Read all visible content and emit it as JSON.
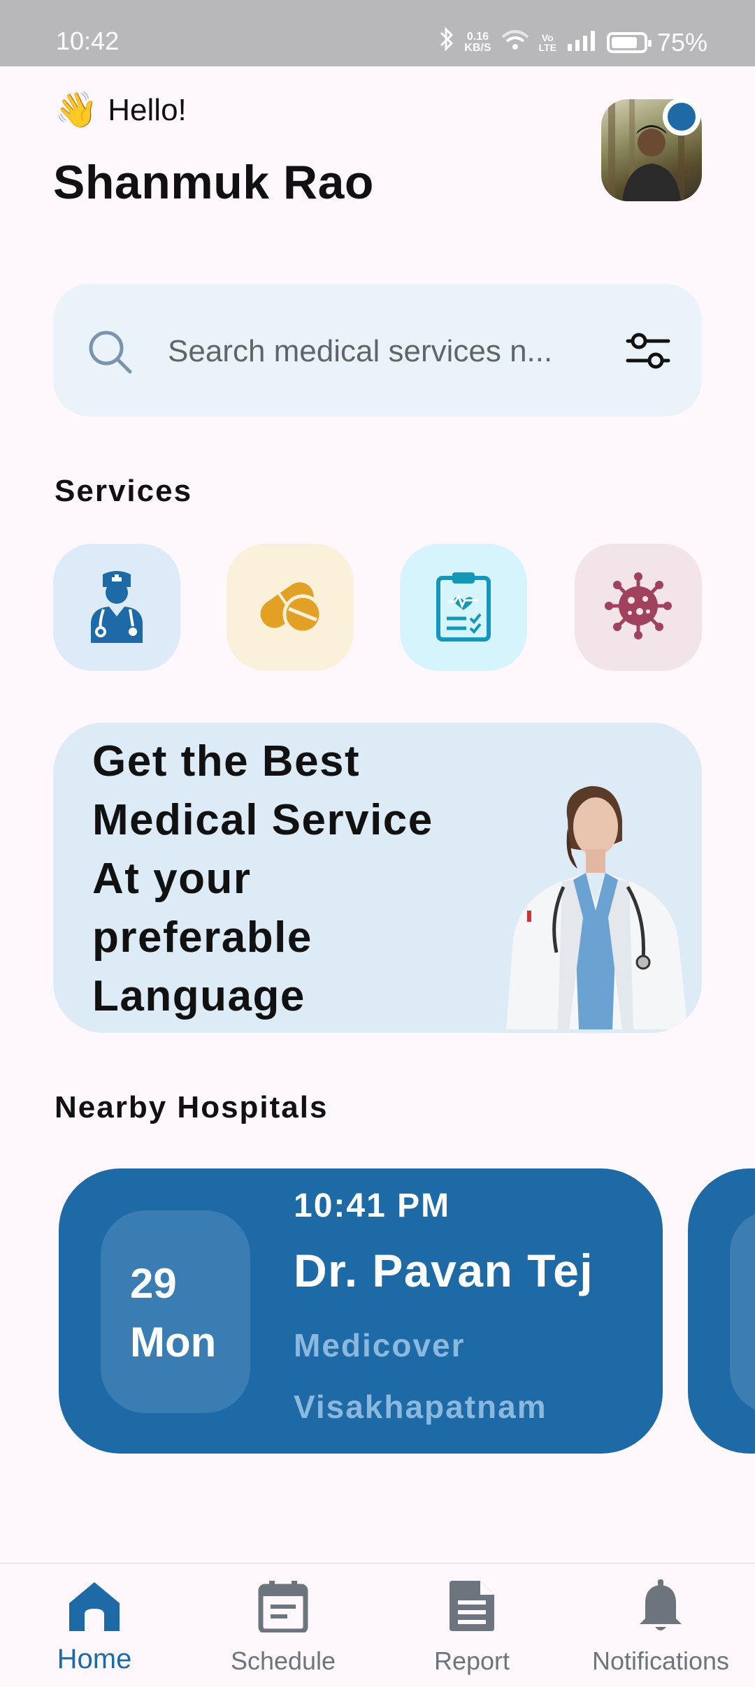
{
  "status_bar": {
    "time": "10:42",
    "net_speed_value": "0.16",
    "net_speed_unit": "KB/S",
    "volte_top": "Vo",
    "volte_bottom": "LTE",
    "battery": "75%"
  },
  "header": {
    "wave_emoji": "👋",
    "greeting": "Hello!",
    "user_name": "Shanmuk Rao"
  },
  "search": {
    "placeholder": "Search medical services n..."
  },
  "services": {
    "title": "Services",
    "items": [
      {
        "icon": "doctor-icon",
        "bg": "#DCEBF7",
        "color": "#1E6AA6"
      },
      {
        "icon": "pills-icon",
        "bg": "#FBF0D9",
        "color": "#E2A024"
      },
      {
        "icon": "clipboard-report-icon",
        "bg": "#D6F4FB",
        "color": "#1597B8"
      },
      {
        "icon": "virus-icon",
        "bg": "#F3E4E9",
        "color": "#A0415E"
      }
    ]
  },
  "banner": {
    "lines": [
      "Get the Best",
      "Medical Service",
      "At your",
      "preferable",
      "Language"
    ]
  },
  "nearby": {
    "title": "Nearby Hospitals",
    "cards": [
      {
        "date_num": "29",
        "date_day": "Mon",
        "time": "10:41 PM",
        "doctor": "Dr. Pavan Tej",
        "hospital": "Medicover",
        "city": "Visakhapatnam"
      }
    ]
  },
  "bottom_nav": {
    "items": [
      {
        "label": "Home",
        "icon": "home-icon",
        "active": true
      },
      {
        "label": "Schedule",
        "icon": "calendar-icon",
        "active": false
      },
      {
        "label": "Report",
        "icon": "report-icon",
        "active": false
      },
      {
        "label": "Notifications",
        "icon": "bell-icon",
        "active": false
      }
    ]
  },
  "colors": {
    "primary": "#1E6AA6",
    "background": "#FEF8FC",
    "status_bar": "#B8B7BA"
  }
}
